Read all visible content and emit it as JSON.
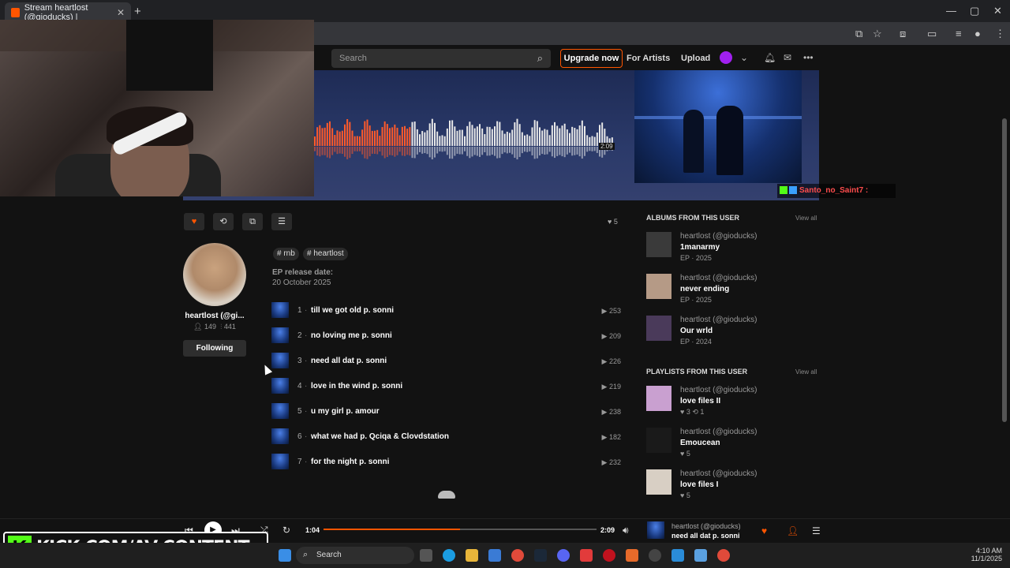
{
  "browser": {
    "tab_title": "Stream heartlost (@gioducks) |",
    "close_glyph": "✕",
    "newtab_glyph": "+",
    "window_controls": [
      "—",
      "▢",
      "✕"
    ]
  },
  "header": {
    "search_placeholder": "Search",
    "upgrade_label": "Upgrade now",
    "for_artists_label": "For Artists",
    "upload_label": "Upload"
  },
  "hero": {
    "duration": "2:09",
    "played_fraction": 0.32
  },
  "chat": {
    "username": "Santo_no_Saint7 :"
  },
  "actions": {
    "like_count": "5"
  },
  "profile": {
    "name": "heartlost (@gi...",
    "followers": "149",
    "following": "441",
    "follow_label": "Following"
  },
  "tags": [
    "# rnb",
    "# heartlost"
  ],
  "release": {
    "label": "EP release date:",
    "date": "20 October 2025"
  },
  "tracks": [
    {
      "num": "1",
      "title": "till we got old p. sonni",
      "plays": "253"
    },
    {
      "num": "2",
      "title": "no loving me p. sonni",
      "plays": "209"
    },
    {
      "num": "3",
      "title": "need all dat p. sonni",
      "plays": "226"
    },
    {
      "num": "4",
      "title": "love in the wind p. sonni",
      "plays": "219"
    },
    {
      "num": "5",
      "title": "u my girl p. amour",
      "plays": "238"
    },
    {
      "num": "6",
      "title": "what we had p. Qciqa & Clovdstation",
      "plays": "182"
    },
    {
      "num": "7",
      "title": "for the night p. sonni",
      "plays": "232"
    }
  ],
  "albums": {
    "heading": "ALBUMS FROM THIS USER",
    "view_all": "View all",
    "items": [
      {
        "artist": "heartlost (@gioducks)",
        "title": "1manarmy",
        "meta": "EP · 2025",
        "color": "#3a3a3a"
      },
      {
        "artist": "heartlost (@gioducks)",
        "title": "never ending",
        "meta": "EP · 2025",
        "color": "#b59a86"
      },
      {
        "artist": "heartlost (@gioducks)",
        "title": "Our wrld",
        "meta": "EP · 2024",
        "color": "#4a3a5a"
      }
    ]
  },
  "playlists": {
    "heading": "PLAYLISTS FROM THIS USER",
    "view_all": "View all",
    "items": [
      {
        "artist": "heartlost (@gioducks)",
        "title": "love files II",
        "meta": "♥ 3  ⟲ 1",
        "color": "#c9a0d0"
      },
      {
        "artist": "heartlost (@gioducks)",
        "title": "Emoucean",
        "meta": "♥ 5",
        "color": "#1a1a1a"
      },
      {
        "artist": "heartlost (@gioducks)",
        "title": "love files I",
        "meta": "♥ 5",
        "color": "#d8cfc4"
      }
    ]
  },
  "player": {
    "current_time": "1:04",
    "total_time": "2:09",
    "progress_fraction": 0.5,
    "artist": "heartlost (@gioducks)",
    "title": "need all dat p. sonni"
  },
  "kick": {
    "letter": "K",
    "text": "KICK.COM/AV CONTENT"
  },
  "taskbar": {
    "search_label": "Search",
    "time": "4:10 AM",
    "date": "11/1/2025"
  },
  "colors": {
    "accent": "#ff5500",
    "kick_green": "#53fc18"
  }
}
